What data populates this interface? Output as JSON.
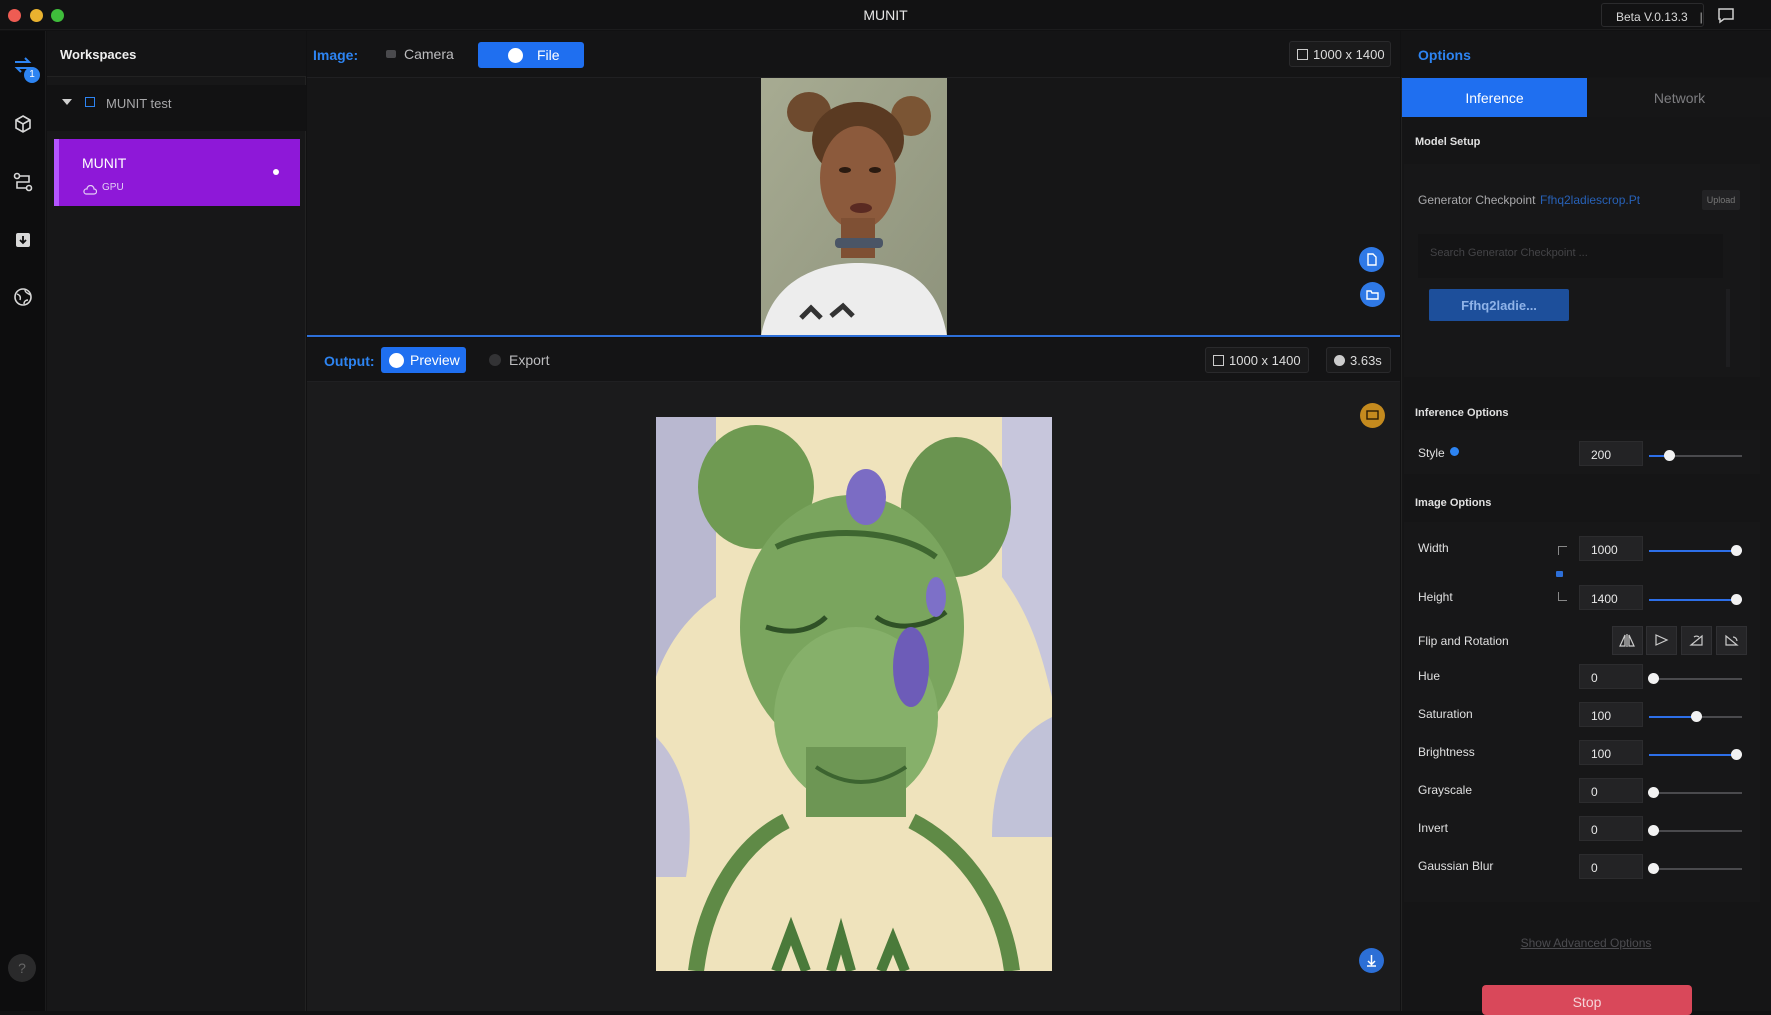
{
  "window": {
    "title": "MUNIT",
    "version": "Beta V.0.13.3"
  },
  "rail": {
    "badge": "1",
    "help": "?"
  },
  "workspaces": {
    "title": "Workspaces",
    "tree_label": "MUNIT test",
    "card": {
      "name": "MUNIT",
      "device": "GPU"
    }
  },
  "image_bar": {
    "label": "Image:",
    "camera_label": "Camera",
    "file_label": "File",
    "dimensions": "1000 x 1400"
  },
  "output_bar": {
    "label": "Output:",
    "preview_label": "Preview",
    "export_label": "Export",
    "dimensions": "1000 x 1400",
    "time": "3.63s"
  },
  "options": {
    "title": "Options",
    "tabs": [
      "Inference",
      "Network"
    ],
    "model_setup": {
      "title": "Model Setup",
      "generator_label": "Generator Checkpoint",
      "generator_value": "Ffhq2ladiescrop.Pt",
      "upload_label": "Upload",
      "search_placeholder": "Search Generator Checkpoint ...",
      "chip": "Ffhq2ladie..."
    },
    "inference": {
      "title": "Inference Options",
      "style": {
        "label": "Style",
        "value": "200",
        "level": 0.22
      }
    },
    "image": {
      "title": "Image Options",
      "width": {
        "label": "Width",
        "value": "1000",
        "level": 0.94
      },
      "height": {
        "label": "Height",
        "value": "1400",
        "level": 0.94
      },
      "flip_label": "Flip and Rotation",
      "sliders": [
        {
          "label": "Hue",
          "value": "0",
          "level": 0.04
        },
        {
          "label": "Saturation",
          "value": "100",
          "level": 0.5
        },
        {
          "label": "Brightness",
          "value": "100",
          "level": 0.94
        },
        {
          "label": "Grayscale",
          "value": "0",
          "level": 0.04
        },
        {
          "label": "Invert",
          "value": "0",
          "level": 0.04
        },
        {
          "label": "Gaussian Blur",
          "value": "0",
          "level": 0.04
        }
      ]
    },
    "advanced_link": "Show Advanced Options",
    "stop_label": "Stop"
  },
  "colors": {
    "accent": "#1f6ff0",
    "workspace": "#8e18d8",
    "stop": "#d9485a"
  }
}
